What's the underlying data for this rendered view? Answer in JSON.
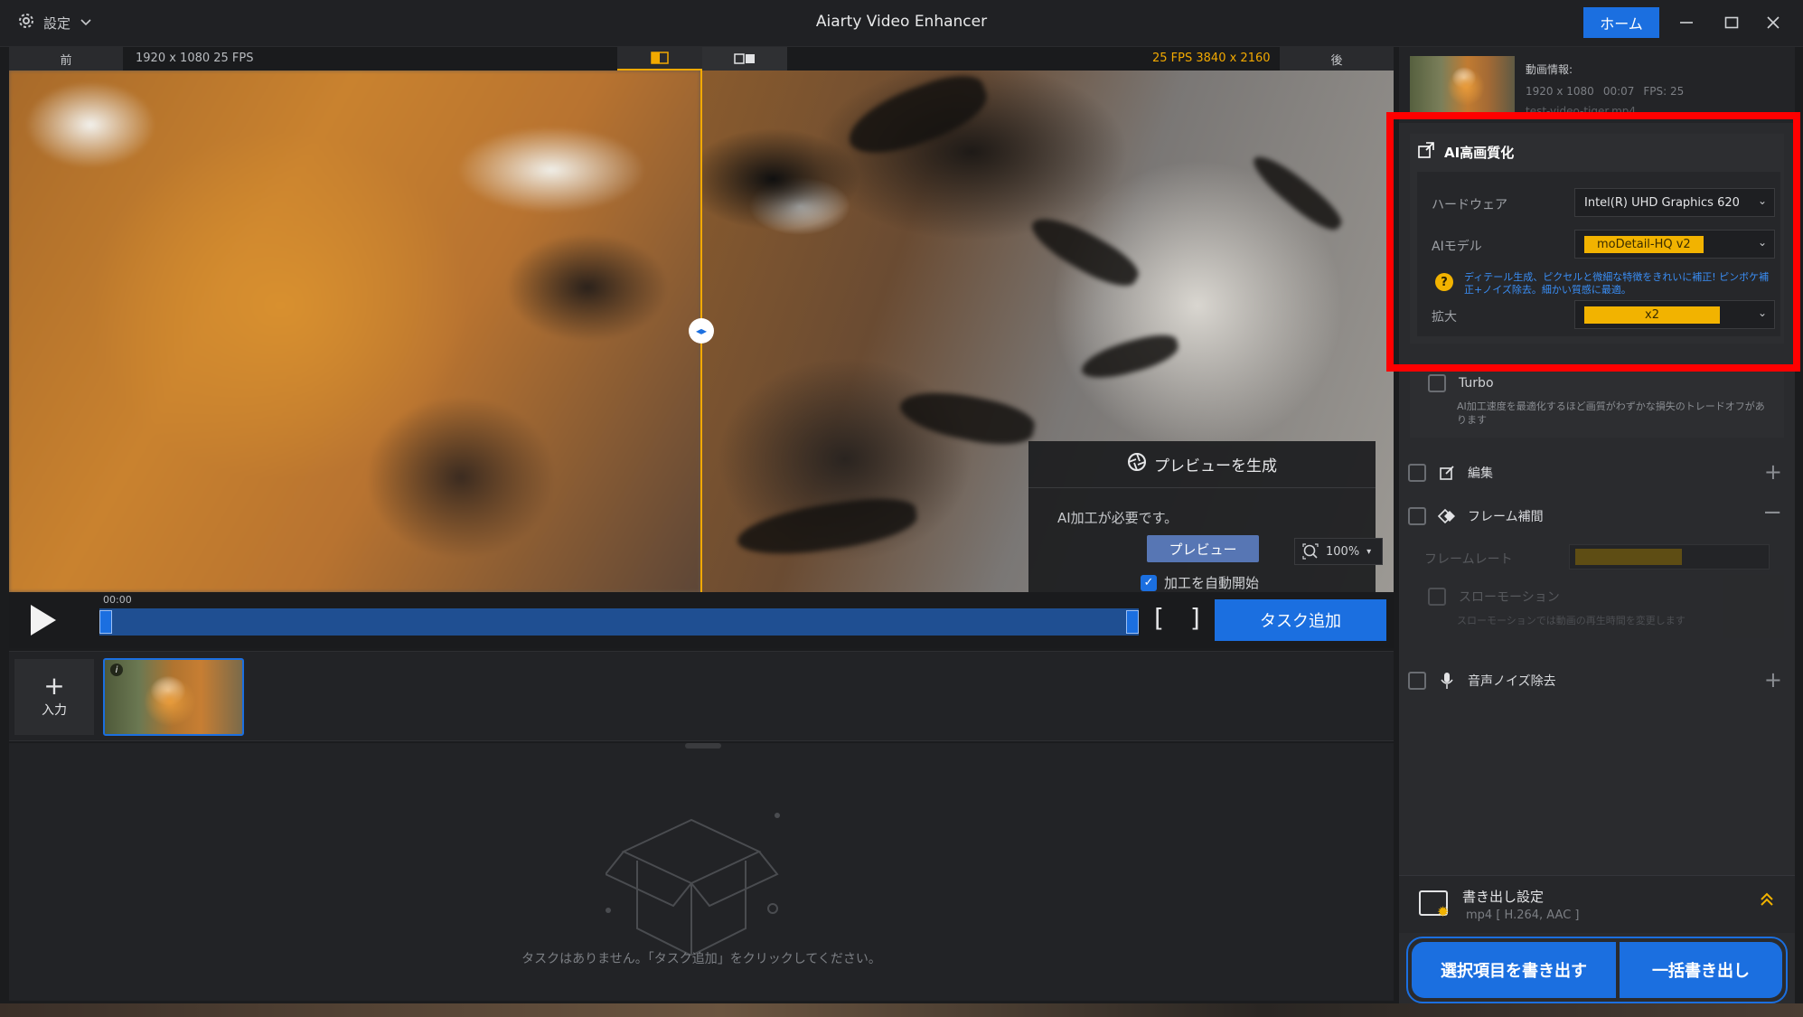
{
  "titlebar": {
    "settings_label": "設定",
    "app_title": "Aiarty Video Enhancer",
    "home_label": "ホーム"
  },
  "compare": {
    "before_label": "前",
    "before_info": "1920 x 1080  25 FPS",
    "after_info": "25 FPS  3840 x 2160",
    "after_label": "後"
  },
  "preview_panel": {
    "title": "プレビューを生成",
    "message": "AI加工が必要です。",
    "preview_button": "プレビュー",
    "auto_start_label": "加工を自動開始",
    "auto_start_checked": true
  },
  "zoom": {
    "value": "100%"
  },
  "playback": {
    "time": "00:00",
    "add_task_label": "タスク追加"
  },
  "tasks": {
    "input_label": "入力",
    "empty_message": "タスクはありません。「タスク追加」をクリックしてください。"
  },
  "video_info": {
    "title": "動画情報:",
    "resolution": "1920 x 1080",
    "duration": "00:07",
    "fps": "FPS: 25",
    "filename": "test-video-tiger.mp4"
  },
  "ai_enhance": {
    "title": "AI高画質化",
    "hardware_label": "ハードウェア",
    "hardware_value": "Intel(R) UHD Graphics 620",
    "model_label": "AIモデル",
    "model_value": "moDetail-HQ  v2",
    "model_hint": "ディテール生成、ピクセルと微細な特徴をきれいに補正! ピンボケ補正+ノイズ除去。細かい質感に最適。",
    "scale_label": "拡大",
    "scale_value": "x2"
  },
  "turbo": {
    "label": "Turbo",
    "description": "AI加工速度を最適化するほど画質がわずかな損失のトレードオフがあります"
  },
  "features": {
    "edit_label": "編集",
    "frame_interp_label": "フレーム補間",
    "frame_rate_label": "フレームレート",
    "slow_motion_label": "スローモーション",
    "slow_motion_desc": "スローモーションでは動画の再生時間を変更します",
    "audio_denoise_label": "音声ノイズ除去"
  },
  "export": {
    "settings_title": "書き出し設定",
    "settings_sub": "mp4 [ H.264, AAC ]",
    "export_selected_label": "選択項目を書き出す",
    "export_all_label": "一括書き出し"
  },
  "colors": {
    "accent": "#1b6fe0",
    "highlight": "#f2b300",
    "annotation": "#ff0000"
  }
}
